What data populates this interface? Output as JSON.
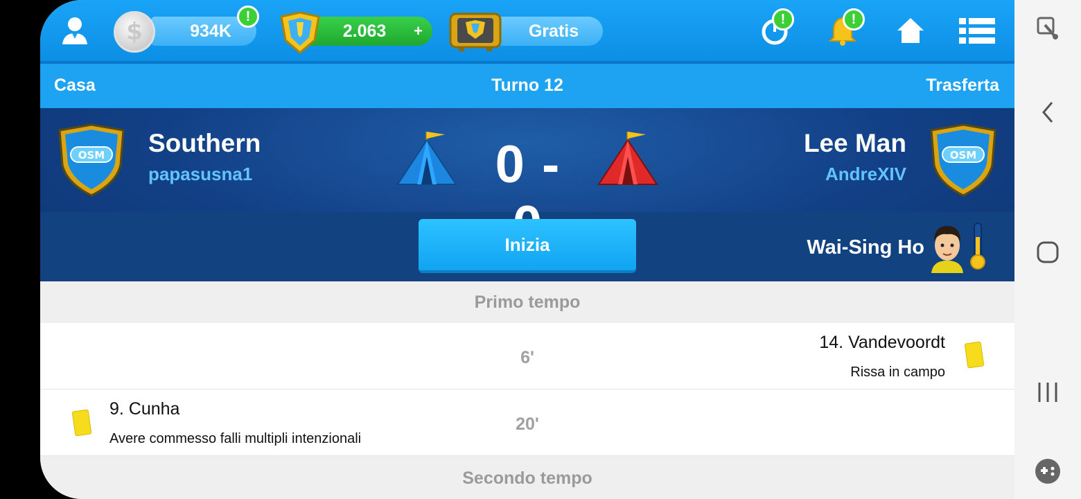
{
  "topbar": {
    "coins": "934K",
    "tokens": "2.063",
    "tokens_plus": "+",
    "tv_label": "Gratis",
    "alert_mark": "!"
  },
  "header": {
    "home_label": "Casa",
    "round_label": "Turno 12",
    "away_label": "Trasferta"
  },
  "match": {
    "home_team": "Southern",
    "home_manager": "papasusna1",
    "score": "0 - 0",
    "away_team": "Lee Man",
    "away_manager": "AndreXIV",
    "badge_text": "OSM",
    "start_label": "Inizia",
    "referee": "Wai-Sing Ho"
  },
  "events": {
    "first_half": "Primo tempo",
    "second_half": "Secondo tempo",
    "items": [
      {
        "minute": "6'",
        "side": "away",
        "player": "14. Vandevoordt",
        "reason": "Rissa in campo",
        "card": "yellow"
      },
      {
        "minute": "20'",
        "side": "home",
        "player": "9. Cunha",
        "reason": "Avere commesso falli multipli intenzionali",
        "card": "yellow"
      }
    ]
  },
  "colors": {
    "topbar": "#1aa4f6",
    "match_bg": "#123f85",
    "home_tent": "#1c86e0",
    "away_tent": "#e02a2a",
    "yellow_card": "#f6dc1c"
  }
}
